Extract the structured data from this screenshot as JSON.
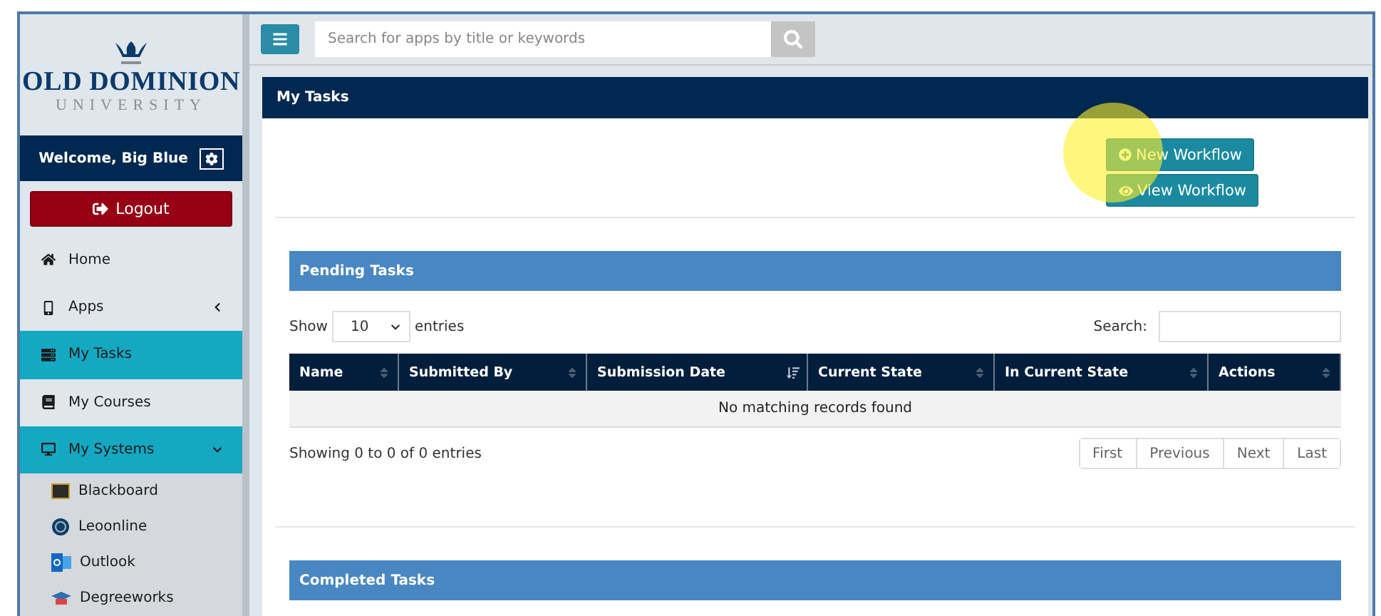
{
  "brand": {
    "name": "OLD DOMINION",
    "subtitle": "UNIVERSITY"
  },
  "welcome": "Welcome, Big Blue",
  "logout": "Logout",
  "nav": [
    {
      "label": "Home",
      "selected": false
    },
    {
      "label": "Apps",
      "selected": false,
      "expanded": false
    },
    {
      "label": "My Tasks",
      "selected": true
    },
    {
      "label": "My Courses",
      "selected": false
    },
    {
      "label": "My Systems",
      "selected": true,
      "expanded": true,
      "children": [
        {
          "label": "Blackboard"
        },
        {
          "label": "Leoonline"
        },
        {
          "label": "Outlook"
        },
        {
          "label": "Degreeworks"
        }
      ]
    }
  ],
  "search": {
    "placeholder": "Search for apps by title or keywords"
  },
  "panel": {
    "title": "My Tasks",
    "buttons": [
      {
        "label": "New Workflow"
      },
      {
        "label": "View Workflow"
      }
    ]
  },
  "pending": {
    "title": "Pending Tasks",
    "show_label": "Show",
    "page_size": "10",
    "entries_label": "entries",
    "search_label": "Search:",
    "columns": [
      {
        "label": "Name",
        "sorted": false
      },
      {
        "label": "Submitted By",
        "sorted": false
      },
      {
        "label": "Submission Date",
        "sorted": true
      },
      {
        "label": "Current State",
        "sorted": false
      },
      {
        "label": "In Current State",
        "sorted": false
      },
      {
        "label": "Actions",
        "sorted": false
      }
    ],
    "empty": "No matching records found",
    "info": "Showing 0 to 0 of 0 entries",
    "pager": [
      "First",
      "Previous",
      "Next",
      "Last"
    ]
  },
  "completed": {
    "title": "Completed Tasks"
  }
}
